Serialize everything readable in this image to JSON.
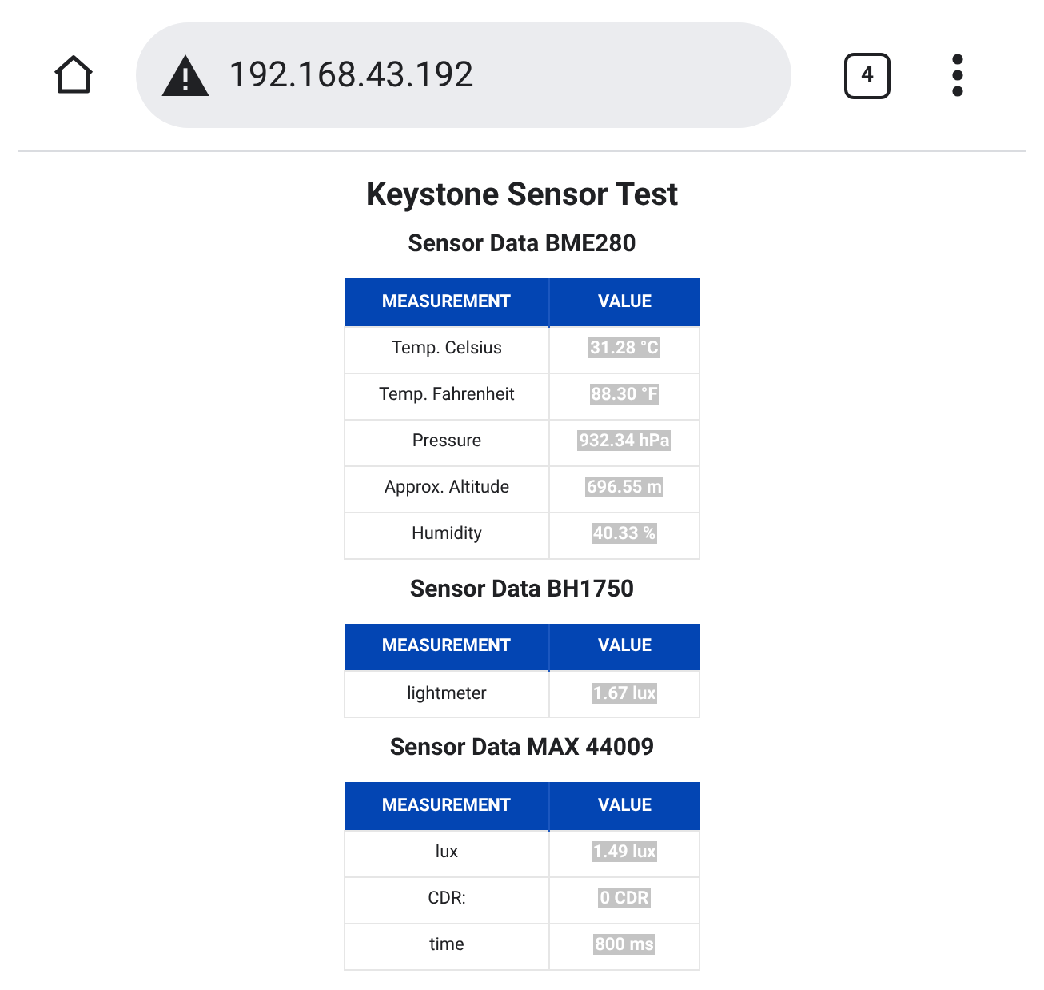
{
  "browser": {
    "url": "192.168.43.192",
    "tab_count": "4"
  },
  "page": {
    "title": "Keystone Sensor Test",
    "sections": [
      {
        "heading": "Sensor Data BME280",
        "columns": [
          "MEASUREMENT",
          "VALUE"
        ],
        "rows": [
          [
            "Temp. Celsius",
            "31.28 °C"
          ],
          [
            "Temp. Fahrenheit",
            "88.30 °F"
          ],
          [
            "Pressure",
            "932.34 hPa"
          ],
          [
            "Approx. Altitude",
            "696.55 m"
          ],
          [
            "Humidity",
            "40.33 %"
          ]
        ]
      },
      {
        "heading": "Sensor Data BH1750",
        "columns": [
          "MEASUREMENT",
          "VALUE"
        ],
        "rows": [
          [
            "lightmeter",
            "1.67 lux"
          ]
        ]
      },
      {
        "heading": "Sensor Data MAX 44009",
        "columns": [
          "MEASUREMENT",
          "VALUE"
        ],
        "rows": [
          [
            "lux",
            "1.49 lux"
          ],
          [
            "CDR:",
            "0 CDR"
          ],
          [
            "time",
            "800 ms"
          ]
        ]
      }
    ]
  }
}
